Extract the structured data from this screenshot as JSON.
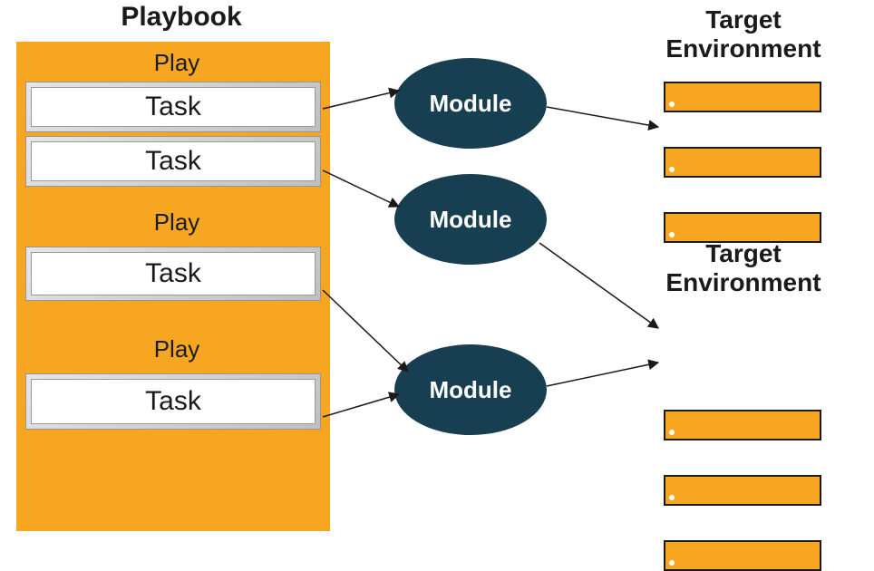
{
  "playbook": {
    "title": "Playbook",
    "plays": [
      {
        "label": "Play",
        "tasks": [
          "Task",
          "Task"
        ]
      },
      {
        "label": "Play",
        "tasks": [
          "Task"
        ]
      },
      {
        "label": "Play",
        "tasks": [
          "Task"
        ]
      }
    ]
  },
  "modules": {
    "label": "Module",
    "count": 3
  },
  "targets": [
    {
      "title": "Target\nEnvironment",
      "hosts": 3
    },
    {
      "title": "Target\nEnvironment",
      "hosts": 3
    }
  ],
  "colors": {
    "accent": "#f6a620",
    "module": "#183e52",
    "text": "#1a1a1a"
  }
}
